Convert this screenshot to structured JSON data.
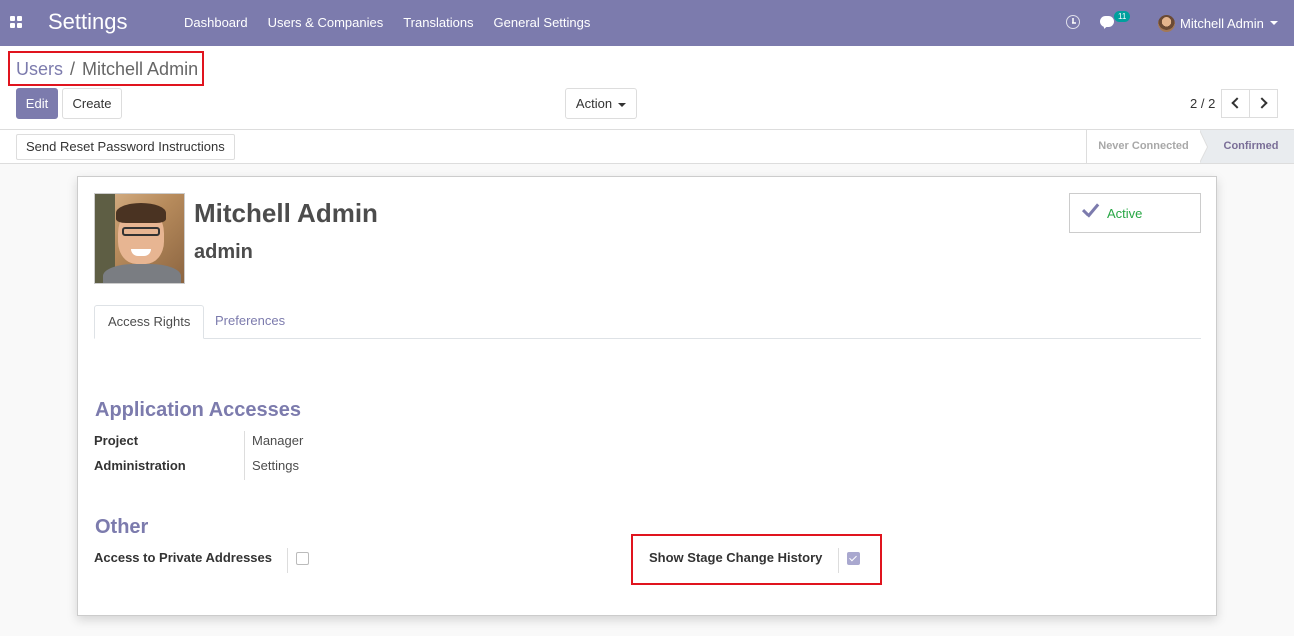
{
  "navbar": {
    "brand": "Settings",
    "menu": [
      "Dashboard",
      "Users & Companies",
      "Translations",
      "General Settings"
    ],
    "messages_badge": "11",
    "user_name": "Mitchell Admin"
  },
  "breadcrumb": {
    "parent": "Users",
    "separator": "/",
    "current": "Mitchell Admin"
  },
  "toolbar": {
    "edit_label": "Edit",
    "create_label": "Create",
    "action_label": "Action",
    "pager_value": "2 / 2"
  },
  "statusbar": {
    "reset_button_label": "Send Reset Password Instructions",
    "stages": [
      "Never Connected",
      "Confirmed"
    ],
    "current_stage": "Confirmed"
  },
  "form": {
    "name": "Mitchell Admin",
    "login": "admin",
    "active_label": "Active",
    "tabs": [
      "Access Rights",
      "Preferences"
    ],
    "active_tab": "Access Rights",
    "application_accesses": {
      "title": "Application Accesses",
      "fields": [
        {
          "label": "Project",
          "value": "Manager"
        },
        {
          "label": "Administration",
          "value": "Settings"
        }
      ]
    },
    "other": {
      "title": "Other",
      "private_addresses_label": "Access to Private Addresses",
      "private_addresses_checked": false,
      "stage_history_label": "Show Stage Change History",
      "stage_history_checked": true
    }
  },
  "colors": {
    "brand": "#7c7bad",
    "highlight": "#e0141e",
    "active_green": "#28a745",
    "badge_teal": "#00a09d"
  }
}
